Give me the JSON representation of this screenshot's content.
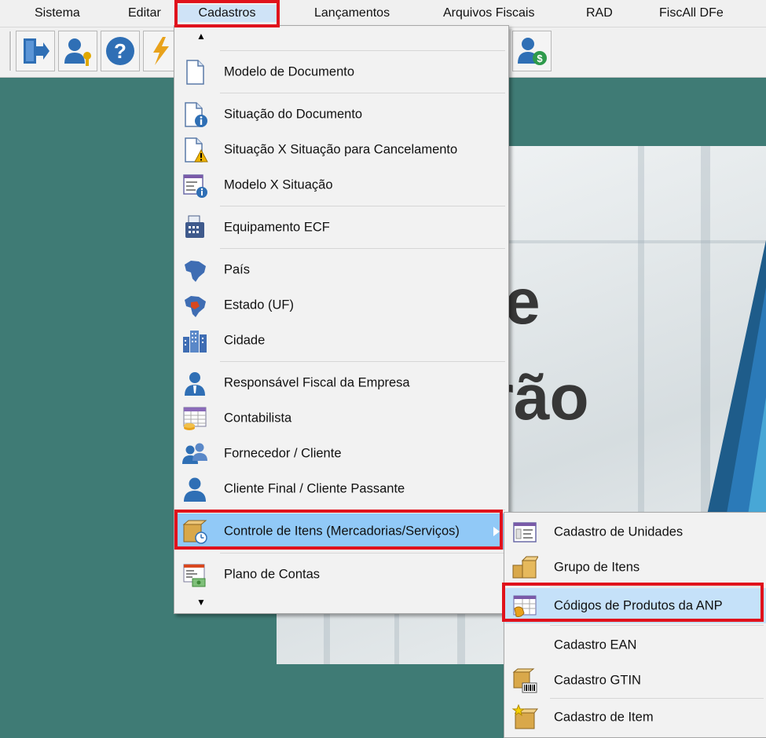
{
  "menubar": {
    "items": [
      {
        "label": "Sistema"
      },
      {
        "label": "Editar"
      },
      {
        "label": "Cadastros"
      },
      {
        "label": "Lançamentos"
      },
      {
        "label": "Arquivos Fiscais"
      },
      {
        "label": "RAD"
      },
      {
        "label": "FiscAll DFe"
      }
    ]
  },
  "toolbar": {
    "buttons": [
      "exit-icon",
      "user-key-icon",
      "help-icon",
      "lightning-icon",
      "user-money-icon"
    ]
  },
  "banner": {
    "line1": "e",
    "line2": "rão"
  },
  "cadastros_menu": {
    "scroll_up": "▲",
    "scroll_down": "▼",
    "items": [
      {
        "label": "Modelo de Documento",
        "icon": "document-icon"
      },
      {
        "label": "Situação do Documento",
        "icon": "document-info-icon"
      },
      {
        "label": "Situação X Situação para Cancelamento",
        "icon": "document-warning-icon"
      },
      {
        "label": "Modelo X Situação",
        "icon": "form-info-icon"
      },
      {
        "label": "Equipamento ECF",
        "icon": "printer-icon"
      },
      {
        "label": "País",
        "icon": "brazil-map-icon"
      },
      {
        "label": "Estado (UF)",
        "icon": "brazil-state-map-icon"
      },
      {
        "label": "Cidade",
        "icon": "city-buildings-icon"
      },
      {
        "label": "Responsável Fiscal da Empresa",
        "icon": "person-tie-icon"
      },
      {
        "label": "Contabilista",
        "icon": "calculator-table-icon"
      },
      {
        "label": "Fornecedor / Cliente",
        "icon": "people-icon"
      },
      {
        "label": "Cliente Final / Cliente Passante",
        "icon": "person-icon"
      },
      {
        "label": "Controle de Itens (Mercadorias/Serviços)",
        "icon": "box-clock-icon"
      },
      {
        "label": "Plano de Contas",
        "icon": "chart-of-accounts-icon"
      }
    ]
  },
  "submenu": {
    "items": [
      {
        "label": "Cadastro de Unidades",
        "icon": "window-units-icon"
      },
      {
        "label": "Grupo de Itens",
        "icon": "boxes-icon"
      },
      {
        "label": "Códigos de Produtos da ANP",
        "icon": "table-hand-icon"
      },
      {
        "label": "Cadastro EAN",
        "icon": ""
      },
      {
        "label": "Cadastro GTIN",
        "icon": "box-barcode-icon"
      },
      {
        "label": "Cadastro de Item",
        "icon": "box-star-icon"
      }
    ]
  },
  "colors": {
    "background": "#3f7b75",
    "highlight": "#91c9f7",
    "annotation_red": "#e0121c"
  }
}
